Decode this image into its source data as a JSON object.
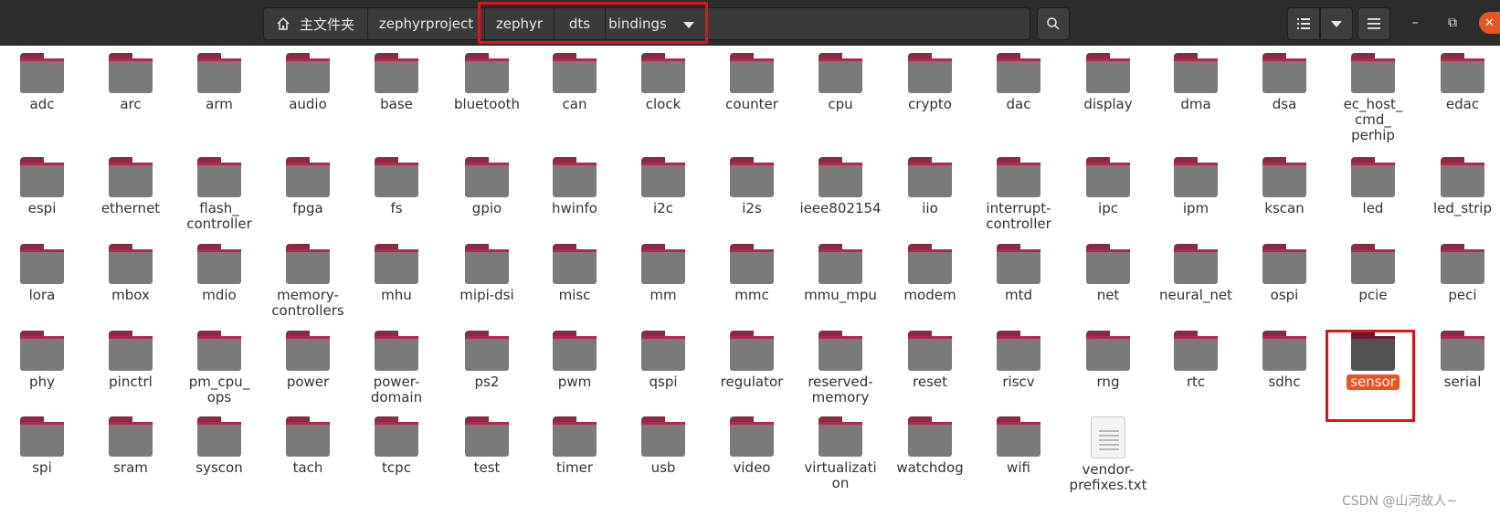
{
  "pathbar": {
    "home_label": "主文件夹",
    "crumbs": [
      "zephyrproject",
      "zephyr",
      "dts",
      "bindings"
    ]
  },
  "icons": {
    "home": "home-icon",
    "search": "search-icon",
    "list_view": "list-view-icon",
    "menu": "hamburger-menu-icon",
    "minimize": "minimize-icon",
    "maximize": "maximize-icon",
    "close": "close-icon"
  },
  "window_buttons": {
    "minimize": "–",
    "maximize": "⧉",
    "close": "✕"
  },
  "colors": {
    "accent": "#e95420",
    "folder_tab": "#8c2a46",
    "folder_body": "#7a7a7a",
    "highlight_box": "#e0121a"
  },
  "items": [
    {
      "label": "adc",
      "type": "folder"
    },
    {
      "label": "arc",
      "type": "folder"
    },
    {
      "label": "arm",
      "type": "folder"
    },
    {
      "label": "audio",
      "type": "folder"
    },
    {
      "label": "base",
      "type": "folder"
    },
    {
      "label": "bluetooth",
      "type": "folder"
    },
    {
      "label": "can",
      "type": "folder"
    },
    {
      "label": "clock",
      "type": "folder"
    },
    {
      "label": "counter",
      "type": "folder"
    },
    {
      "label": "cpu",
      "type": "folder"
    },
    {
      "label": "crypto",
      "type": "folder"
    },
    {
      "label": "dac",
      "type": "folder"
    },
    {
      "label": "display",
      "type": "folder"
    },
    {
      "label": "dma",
      "type": "folder"
    },
    {
      "label": "dsa",
      "type": "folder"
    },
    {
      "label": "ec_host_\ncmd_\nperhip",
      "type": "folder"
    },
    {
      "label": "edac",
      "type": "folder"
    },
    {
      "label": "espi",
      "type": "folder"
    },
    {
      "label": "ethernet",
      "type": "folder"
    },
    {
      "label": "flash_\ncontroller",
      "type": "folder"
    },
    {
      "label": "fpga",
      "type": "folder"
    },
    {
      "label": "fs",
      "type": "folder"
    },
    {
      "label": "gpio",
      "type": "folder"
    },
    {
      "label": "hwinfo",
      "type": "folder"
    },
    {
      "label": "i2c",
      "type": "folder"
    },
    {
      "label": "i2s",
      "type": "folder"
    },
    {
      "label": "ieee802154",
      "type": "folder"
    },
    {
      "label": "iio",
      "type": "folder"
    },
    {
      "label": "interrupt-\ncontroller",
      "type": "folder"
    },
    {
      "label": "ipc",
      "type": "folder"
    },
    {
      "label": "ipm",
      "type": "folder"
    },
    {
      "label": "kscan",
      "type": "folder"
    },
    {
      "label": "led",
      "type": "folder"
    },
    {
      "label": "led_strip",
      "type": "folder"
    },
    {
      "label": "lora",
      "type": "folder"
    },
    {
      "label": "mbox",
      "type": "folder"
    },
    {
      "label": "mdio",
      "type": "folder"
    },
    {
      "label": "memory-\ncontrollers",
      "type": "folder"
    },
    {
      "label": "mhu",
      "type": "folder"
    },
    {
      "label": "mipi-dsi",
      "type": "folder"
    },
    {
      "label": "misc",
      "type": "folder"
    },
    {
      "label": "mm",
      "type": "folder"
    },
    {
      "label": "mmc",
      "type": "folder"
    },
    {
      "label": "mmu_mpu",
      "type": "folder"
    },
    {
      "label": "modem",
      "type": "folder"
    },
    {
      "label": "mtd",
      "type": "folder"
    },
    {
      "label": "net",
      "type": "folder"
    },
    {
      "label": "neural_net",
      "type": "folder"
    },
    {
      "label": "ospi",
      "type": "folder"
    },
    {
      "label": "pcie",
      "type": "folder"
    },
    {
      "label": "peci",
      "type": "folder"
    },
    {
      "label": "phy",
      "type": "folder"
    },
    {
      "label": "pinctrl",
      "type": "folder"
    },
    {
      "label": "pm_cpu_\nops",
      "type": "folder"
    },
    {
      "label": "power",
      "type": "folder"
    },
    {
      "label": "power-\ndomain",
      "type": "folder"
    },
    {
      "label": "ps2",
      "type": "folder"
    },
    {
      "label": "pwm",
      "type": "folder"
    },
    {
      "label": "qspi",
      "type": "folder"
    },
    {
      "label": "regulator",
      "type": "folder"
    },
    {
      "label": "reserved-\nmemory",
      "type": "folder"
    },
    {
      "label": "reset",
      "type": "folder"
    },
    {
      "label": "riscv",
      "type": "folder"
    },
    {
      "label": "rng",
      "type": "folder"
    },
    {
      "label": "rtc",
      "type": "folder"
    },
    {
      "label": "sdhc",
      "type": "folder"
    },
    {
      "label": "sensor",
      "type": "folder",
      "selected": true
    },
    {
      "label": "serial",
      "type": "folder"
    },
    {
      "label": "spi",
      "type": "folder"
    },
    {
      "label": "sram",
      "type": "folder"
    },
    {
      "label": "syscon",
      "type": "folder"
    },
    {
      "label": "tach",
      "type": "folder"
    },
    {
      "label": "tcpc",
      "type": "folder"
    },
    {
      "label": "test",
      "type": "folder"
    },
    {
      "label": "timer",
      "type": "folder"
    },
    {
      "label": "usb",
      "type": "folder"
    },
    {
      "label": "video",
      "type": "folder"
    },
    {
      "label": "virtualizati\non",
      "type": "folder"
    },
    {
      "label": "watchdog",
      "type": "folder"
    },
    {
      "label": "wifi",
      "type": "folder"
    },
    {
      "label": "vendor-\nprefixes.txt",
      "type": "file"
    }
  ],
  "watermark": "CSDN @山河故人~"
}
